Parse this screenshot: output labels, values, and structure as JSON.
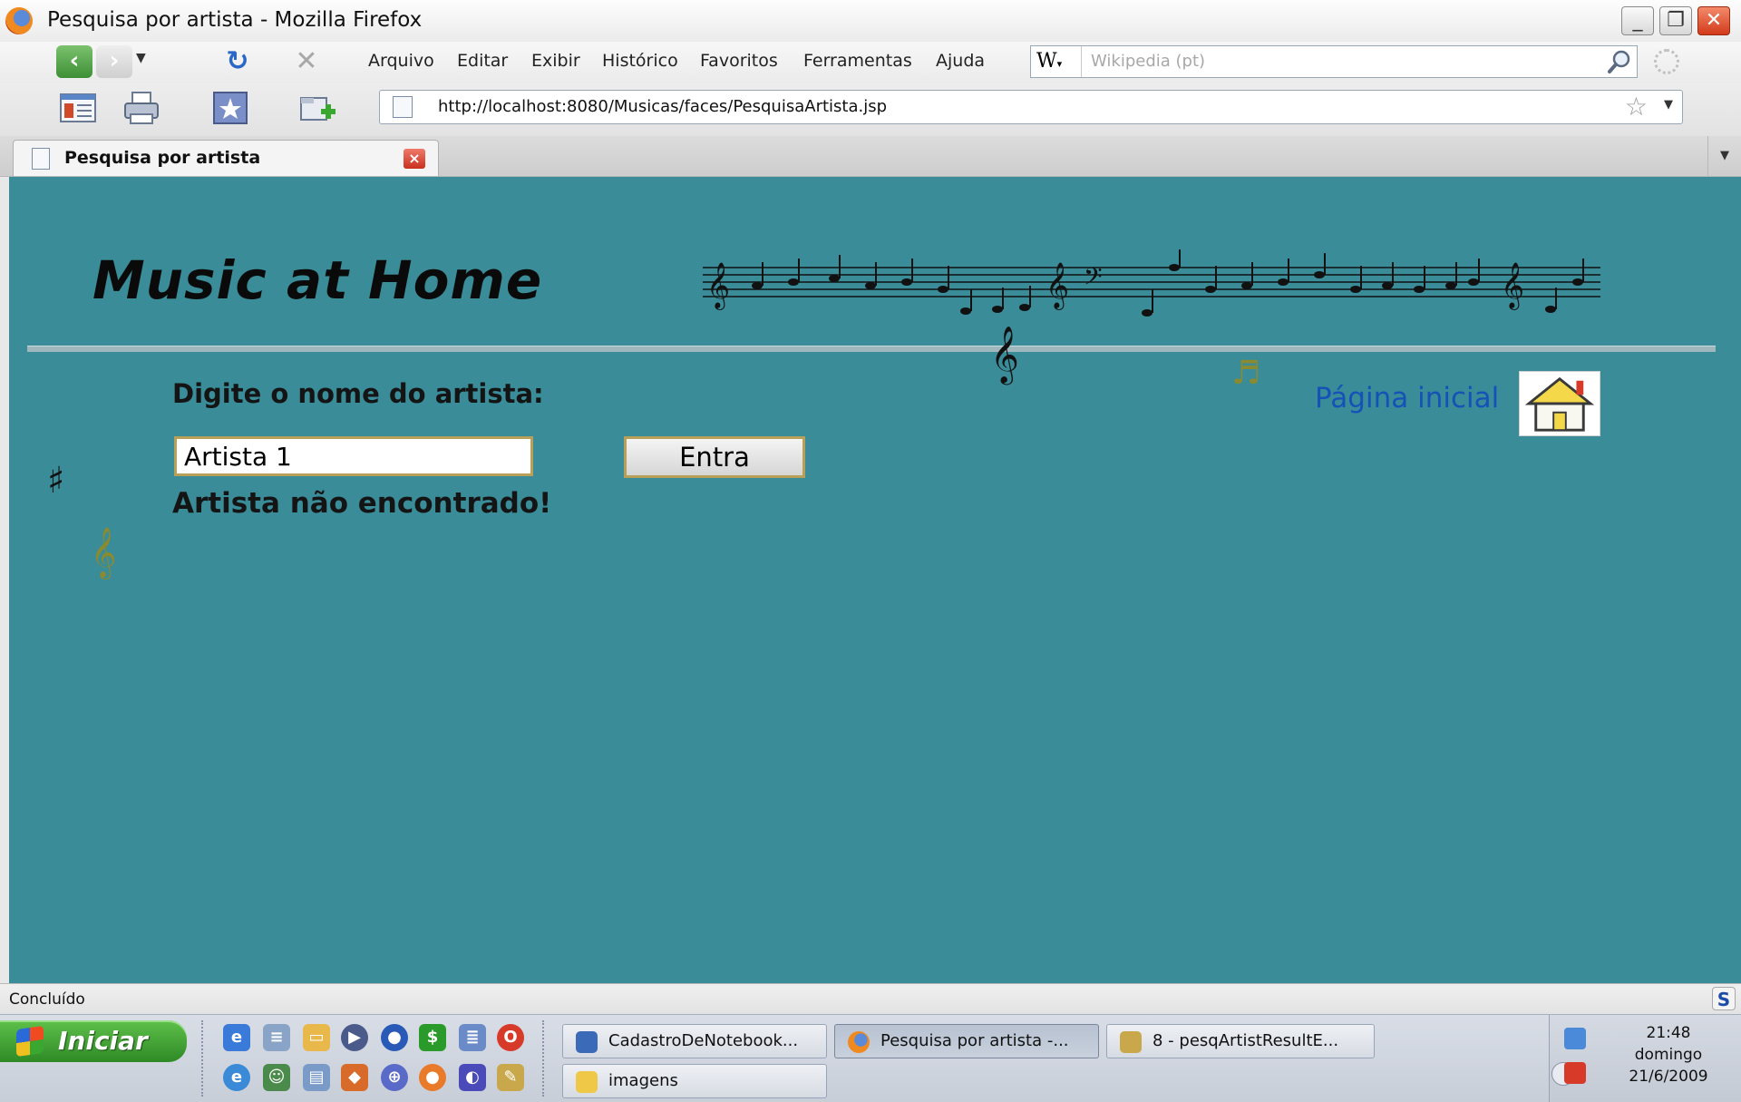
{
  "window": {
    "title": "Pesquisa por artista - Mozilla Firefox",
    "controls": {
      "minimize": "_",
      "maximize": "❐",
      "close": "✕"
    }
  },
  "menu": {
    "items": [
      "Arquivo",
      "Editar",
      "Exibir",
      "Histórico",
      "Favoritos",
      "Ferramentas",
      "Ajuda"
    ]
  },
  "search": {
    "engine_label": "W",
    "placeholder": "Wikipedia (pt)"
  },
  "address": {
    "url": "http://localhost:8080/Musicas/faces/PesquisaArtista.jsp"
  },
  "tab": {
    "label": "Pesquisa por artista"
  },
  "page": {
    "site_title": "Music at Home",
    "prompt_label": "Digite o nome do artista:",
    "artist_value": "Artista 1",
    "submit_label": "Entra",
    "result_message": "Artista não encontrado!",
    "home_link": "Página inicial"
  },
  "status": {
    "text": "Concluído"
  },
  "taskbar": {
    "start_label": "Iniciar",
    "buttons": [
      {
        "label": "CadastroDeNotebook...",
        "icon": "app-icon"
      },
      {
        "label": "Pesquisa por artista -...",
        "icon": "firefox-icon"
      },
      {
        "label": "8 - pesqArtistResultE...",
        "icon": "paint-icon"
      },
      {
        "label": "imagens",
        "icon": "folder-icon"
      }
    ],
    "clock": {
      "time": "21:48",
      "day": "domingo",
      "date": "21/6/2009"
    }
  },
  "colors": {
    "page_background": "#3a8c98",
    "link": "#1552b8",
    "input_border": "#b8a058",
    "start_green": "#3d9a32"
  }
}
